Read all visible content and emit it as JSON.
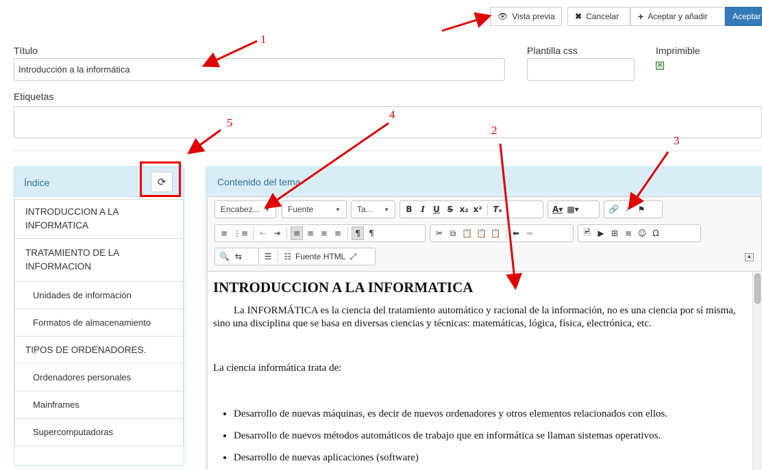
{
  "toolbar": {
    "preview_label": "Vista previa",
    "cancel_label": "Cancelar",
    "accept_add_label": "Aceptar y añadir",
    "accept_label": "Aceptar"
  },
  "form": {
    "title_label": "Título",
    "title_value": "Introducción a la informática",
    "css_label": "Plantilla css",
    "css_value": "",
    "printable_label": "Imprimible",
    "printable_checked": true,
    "tags_label": "Etiquetas",
    "tags_value": ""
  },
  "index": {
    "heading": "Índice",
    "items": [
      {
        "label": "INTRODUCCION A LA INFORMATICA",
        "level": 1
      },
      {
        "label": "TRATAMIENTO DE LA INFORMACION",
        "level": 1
      },
      {
        "label": "Unidades de información",
        "level": 2
      },
      {
        "label": "Formatos de almacenamiento",
        "level": 2
      },
      {
        "label": "TIPOS DE ORDENADORES.",
        "level": 1
      },
      {
        "label": "Ordenadores personales",
        "level": 2
      },
      {
        "label": "Mainframes",
        "level": 2
      },
      {
        "label": "Supercomputadoras",
        "level": 2
      }
    ]
  },
  "content": {
    "heading": "Contenido del tema",
    "toolbar": {
      "format_combo": "Encabez...",
      "font_combo": "Fuente",
      "size_combo": "Ta...",
      "source_label": "Fuente HTML"
    },
    "doc": {
      "h1": "INTRODUCCION A LA INFORMATICA",
      "intro": "La INFORMÁTICA es la ciencia del tratamiento automático y racional de la información, no es una ciencia por sí misma, sino una disciplina que se basa en diversas ciencias y técnicas: matemáticas, lógica, física, electrónica, etc.",
      "sub": "La ciencia informática trata de:",
      "bullets": [
        "Desarrollo de nuevas máquinas, es decir de nuevos ordenadores y otros elementos relacionados con ellos.",
        "Desarrollo de nuevos métodos automáticos de trabajo que en informática se llaman sistemas operativos.",
        "Desarrollo de nuevas aplicaciones (software)"
      ]
    }
  },
  "annotations": [
    "1",
    "2",
    "3",
    "4",
    "5"
  ],
  "colors": {
    "annotation": "#e00000",
    "panel_header_bg": "#d9edf7",
    "panel_header_text": "#31708f",
    "primary_button": "#337ab7"
  },
  "icons": [
    "eye-icon",
    "close-icon",
    "plus-icon",
    "refresh-icon",
    "checkbox-icon"
  ]
}
